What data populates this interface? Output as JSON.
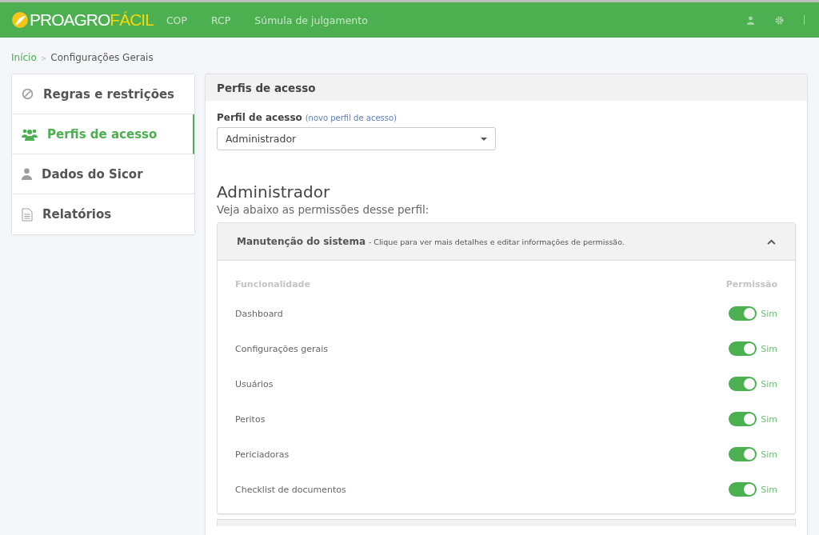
{
  "header": {
    "logo": {
      "text_main": "PROAGRO",
      "text_accent": "FÁCIL"
    },
    "nav": [
      "COP",
      "RCP",
      "Súmula de julgamento"
    ]
  },
  "breadcrumb": {
    "items": [
      "Início",
      "Configurações Gerais"
    ],
    "separator": ">"
  },
  "sidebar": {
    "items": [
      {
        "label": "Regras e restrições",
        "kind": "ban",
        "selected": false
      },
      {
        "label": "Perfis de acesso",
        "kind": "users",
        "selected": true
      },
      {
        "label": "Dados do Sicor",
        "kind": "user",
        "selected": false
      },
      {
        "label": "Relatórios",
        "kind": "document",
        "selected": false
      }
    ]
  },
  "panel": {
    "title": "Perfis de acesso",
    "field_label": "Perfil de acesso",
    "field_link_open": "(",
    "field_link": "novo perfil de acesso",
    "field_link_close": ")",
    "select_value": "Administrador",
    "profile_title": "Administrador",
    "profile_subtitle": "Veja abaixo as permissões desse perfil:",
    "section": {
      "title": "Manutenção do sistema",
      "hint": "- Clique para ver mais detalhes e editar informações de permissão.",
      "expanded": true,
      "columns": [
        "Funcionalidade",
        "Permissão"
      ],
      "rows": [
        {
          "name": "Dashboard",
          "on": true,
          "state_label": "Sim"
        },
        {
          "name": "Configurações gerais",
          "on": true,
          "state_label": "Sim"
        },
        {
          "name": "Usuários",
          "on": true,
          "state_label": "Sim"
        },
        {
          "name": "Peritos",
          "on": true,
          "state_label": "Sim"
        },
        {
          "name": "Periciadoras",
          "on": true,
          "state_label": "Sim"
        },
        {
          "name": "Checklist de documentos",
          "on": true,
          "state_label": "Sim"
        }
      ]
    }
  }
}
